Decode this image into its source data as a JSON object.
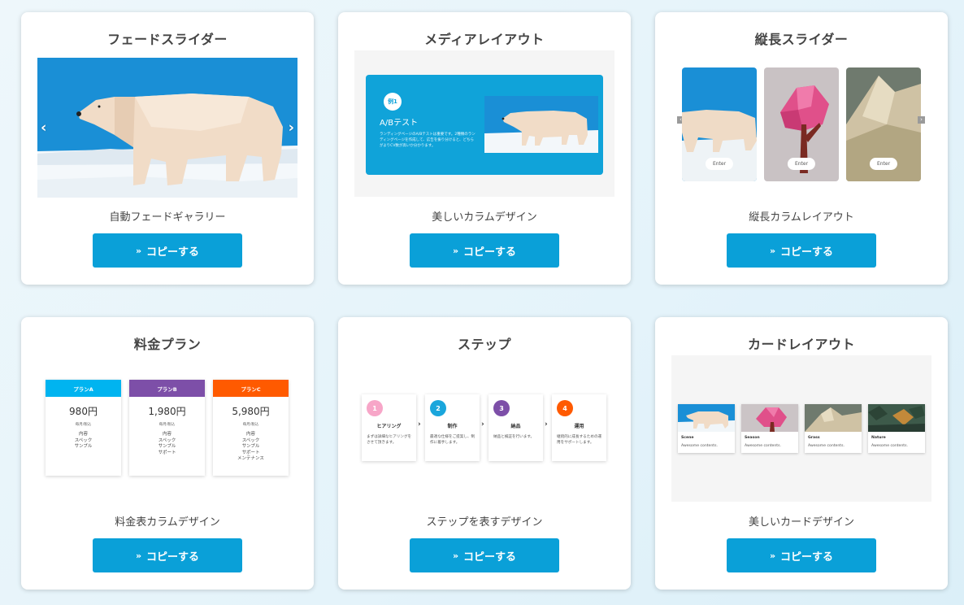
{
  "copy_label": "コピーする",
  "cards": [
    {
      "title": "フェードスライダー",
      "desc": "自動フェードギャラリー"
    },
    {
      "title": "メディアレイアウト",
      "desc": "美しいカラムデザイン"
    },
    {
      "title": "縦長スライダー",
      "desc": "縦長カラムレイアウト"
    },
    {
      "title": "料金プラン",
      "desc": "料金表カラムデザイン"
    },
    {
      "title": "ステップ",
      "desc": "ステップを表すデザイン"
    },
    {
      "title": "カードレイアウト",
      "desc": "美しいカードデザイン"
    }
  ],
  "media": {
    "badge": "例1",
    "heading": "A/Bテスト",
    "text": "ランディングページのA/Bテストは重要です。2種類のランディングページを作成して、広告を振り分けると、どちらがよりCV数が高いか分かります。"
  },
  "vertical": {
    "enter_label": "Enter"
  },
  "pricing": {
    "note": "毎月/税込",
    "plans": [
      {
        "name": "プランA",
        "price": "980円",
        "color": "#00b4f0",
        "items": [
          "内容",
          "スペック",
          "サンプル"
        ]
      },
      {
        "name": "プランB",
        "price": "1,980円",
        "color": "#7d4fa8",
        "items": [
          "内容",
          "スペック",
          "サンプル",
          "サポート"
        ]
      },
      {
        "name": "プランC",
        "price": "5,980円",
        "color": "#ff5a00",
        "items": [
          "内容",
          "スペック",
          "サンプル",
          "サポート",
          "メンテナンス"
        ]
      }
    ]
  },
  "steps": [
    {
      "num": "1",
      "name": "ヒアリング",
      "desc": "まずは詳細なヒアリングをさせて頂きます。",
      "color": "#f7a6c8"
    },
    {
      "num": "2",
      "name": "制作",
      "desc": "最適な仕様をご提案し、制作に着手します。",
      "color": "#1aa6dc"
    },
    {
      "num": "3",
      "name": "納品",
      "desc": "納品と検証を行います。",
      "color": "#7d4fa8"
    },
    {
      "num": "4",
      "name": "運用",
      "desc": "継続的に成長するための運用をサポートします。",
      "color": "#ff5a00"
    }
  ],
  "mini_cards": [
    {
      "title": "Scene",
      "text": "Awesome contents."
    },
    {
      "title": "Season",
      "text": "Awesome contents."
    },
    {
      "title": "Grass",
      "text": "Awesome contents."
    },
    {
      "title": "Nature",
      "text": "Awesome contents."
    }
  ]
}
